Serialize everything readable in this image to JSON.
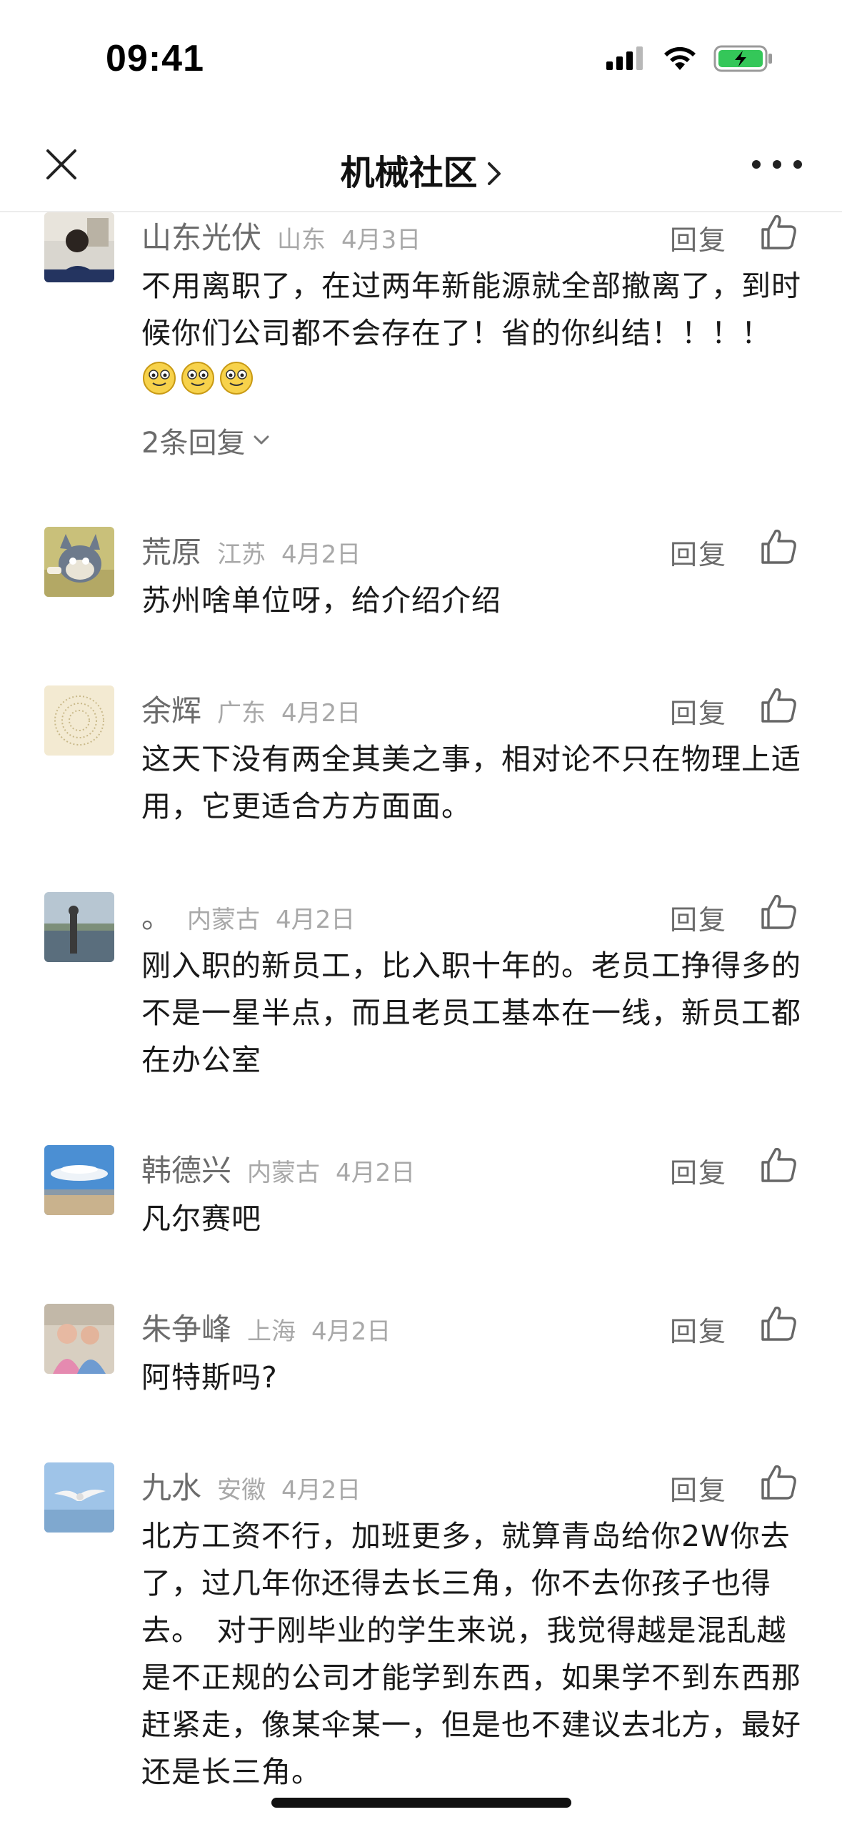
{
  "status_bar": {
    "time": "09:41",
    "icons": [
      "cellular-signal-icon",
      "wifi-icon",
      "battery-charging-icon"
    ]
  },
  "nav": {
    "title": "机械社区",
    "close_icon": "close-icon",
    "more_icon": "more-dots-icon"
  },
  "comments": [
    {
      "author": "山东光伏",
      "region": "山东",
      "date": "4月3日",
      "reply_label": "回复",
      "text": "不用离职了，在过两年新能源就全部撤离了，到时候你们公司都不会存在了！省的你纠结！！！！",
      "emojis": [
        "grin-emoji",
        "grin-emoji",
        "grin-emoji"
      ],
      "replies_label": "2条回复"
    },
    {
      "author": "荒原",
      "region": "江苏",
      "date": "4月2日",
      "reply_label": "回复",
      "text": "苏州啥单位呀，给介绍介绍"
    },
    {
      "author": "余辉",
      "region": "广东",
      "date": "4月2日",
      "reply_label": "回复",
      "text": "这天下没有两全其美之事，相对论不只在物理上适用，它更适合方方面面。"
    },
    {
      "author": "。",
      "region": "内蒙古",
      "date": "4月2日",
      "reply_label": "回复",
      "text": "刚入职的新员工，比入职十年的。老员工挣得多的不是一星半点，而且老员工基本在一线，新员工都在办公室"
    },
    {
      "author": "韩德兴",
      "region": "内蒙古",
      "date": "4月2日",
      "reply_label": "回复",
      "text": "凡尔赛吧"
    },
    {
      "author": "朱争峰",
      "region": "上海",
      "date": "4月2日",
      "reply_label": "回复",
      "text": "阿特斯吗?"
    },
    {
      "author": "九水",
      "region": "安徽",
      "date": "4月2日",
      "reply_label": "回复",
      "text": "北方工资不行，加班更多，就算青岛给你2W你去了，过几年你还得去长三角，你不去你孩子也得去。　对于刚毕业的学生来说，我觉得越是混乱越是不正规的公司才能学到东西，如果学不到东西那赶紧走，像某伞某一，但是也不建议去北方，最好还是长三角。"
    }
  ]
}
